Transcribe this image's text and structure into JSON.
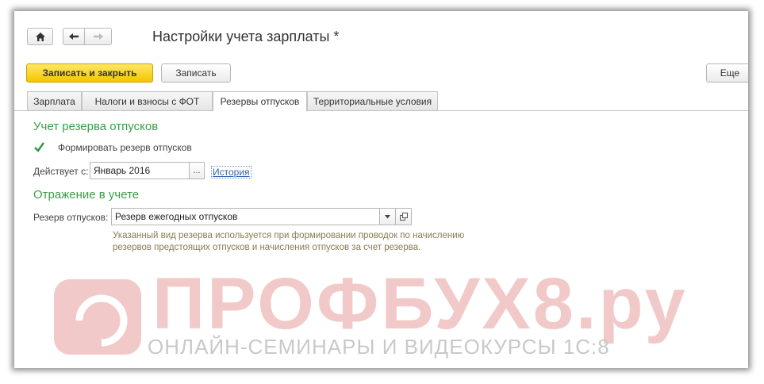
{
  "window": {
    "title": "Настройки учета зарплаты *"
  },
  "nav": {
    "home_icon": "home-icon",
    "back_icon": "arrow-left-icon",
    "forward_icon": "arrow-right-icon"
  },
  "toolbar": {
    "save_close_label": "Записать и закрыть",
    "save_label": "Записать",
    "more_label": "Еще"
  },
  "tabs": [
    {
      "label": "Зарплата",
      "active": false
    },
    {
      "label": "Налоги и взносы с ФОТ",
      "active": false
    },
    {
      "label": "Резервы отпусков",
      "active": true
    },
    {
      "label": "Территориальные условия",
      "active": false
    }
  ],
  "reserve_section": {
    "heading": "Учет резерва отпусков",
    "checkbox_label": "Формировать резерв отпусков",
    "checkbox_checked": true,
    "effective_label": "Действует с:",
    "effective_value": "Январь 2016",
    "picker_label": "...",
    "history_link": "История"
  },
  "accounting_section": {
    "heading": "Отражение в учете",
    "reserve_label": "Резерв отпусков:",
    "reserve_value": "Резерв ежегодных отпусков",
    "hint_line1": "Указанный вид резерва используется при формировании проводок по начислению",
    "hint_line2": "резервов предстоящих отпусков и начисления отпусков за счет резерва."
  },
  "watermark": {
    "brand": "ПРОФБУХ8.ру",
    "tagline": "ОНЛАЙН-СЕМИНАРЫ И ВИДЕОКУРСЫ 1С:8"
  },
  "colors": {
    "accent_green": "#3a9e46",
    "primary_yellow": "#f7d21e",
    "link_blue": "#3366aa",
    "watermark_pink": "#f2c9c9"
  }
}
